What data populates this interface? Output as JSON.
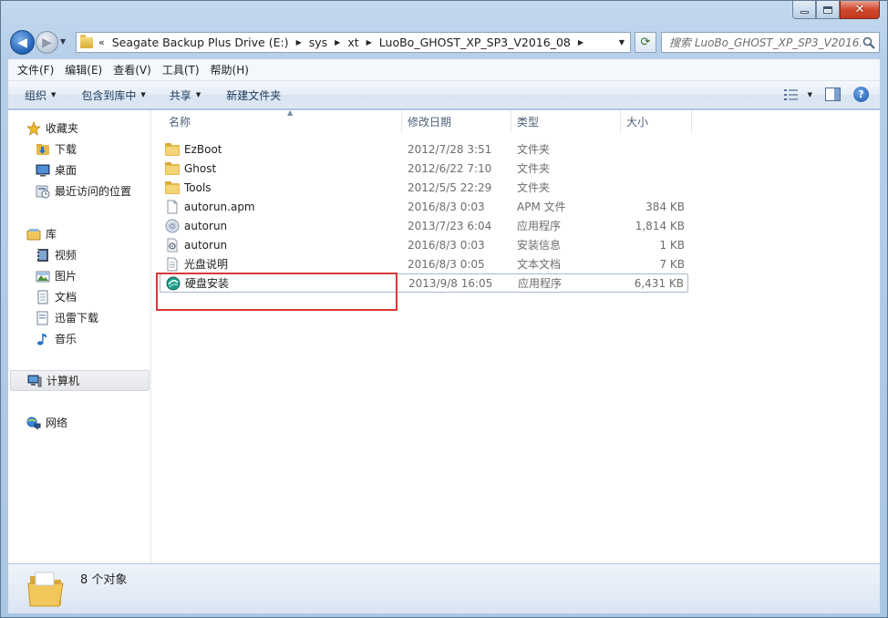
{
  "address": {
    "crumbs": [
      "Seagate Backup Plus Drive (E:)",
      "sys",
      "xt",
      "LuoBo_GHOST_XP_SP3_V2016_08"
    ],
    "overflow": "«"
  },
  "search": {
    "placeholder": "搜索 LuoBo_GHOST_XP_SP3_V2016..."
  },
  "menubar": [
    "文件(F)",
    "编辑(E)",
    "查看(V)",
    "工具(T)",
    "帮助(H)"
  ],
  "commandbar": {
    "organize": "组织",
    "include_library": "包含到库中",
    "share": "共享",
    "new_folder": "新建文件夹"
  },
  "navpane": {
    "favorites": {
      "label": "收藏夹",
      "items": [
        "下载",
        "桌面",
        "最近访问的位置"
      ]
    },
    "libraries": {
      "label": "库",
      "items": [
        "视频",
        "图片",
        "文档",
        "迅雷下载",
        "音乐"
      ]
    },
    "computer": "计算机",
    "network": "网络"
  },
  "columns": {
    "name": "名称",
    "date": "修改日期",
    "type": "类型",
    "size": "大小"
  },
  "files": [
    {
      "name": "EzBoot",
      "date": "2012/7/28 3:51",
      "type": "文件夹",
      "size": "",
      "icon": "folder-icon"
    },
    {
      "name": "Ghost",
      "date": "2012/6/22 7:10",
      "type": "文件夹",
      "size": "",
      "icon": "folder-icon"
    },
    {
      "name": "Tools",
      "date": "2012/5/5 22:29",
      "type": "文件夹",
      "size": "",
      "icon": "folder-icon"
    },
    {
      "name": "autorun.apm",
      "date": "2016/8/3 0:03",
      "type": "APM 文件",
      "size": "384 KB",
      "icon": "file-icon"
    },
    {
      "name": "autorun",
      "date": "2013/7/23 6:04",
      "type": "应用程序",
      "size": "1,814 KB",
      "icon": "disc-app-icon"
    },
    {
      "name": "autorun",
      "date": "2016/8/3 0:03",
      "type": "安装信息",
      "size": "1 KB",
      "icon": "setup-info-icon"
    },
    {
      "name": "光盘说明",
      "date": "2016/8/3 0:05",
      "type": "文本文档",
      "size": "7 KB",
      "icon": "text-file-icon"
    },
    {
      "name": "硬盘安装",
      "date": "2013/9/8 16:05",
      "type": "应用程序",
      "size": "6,431 KB",
      "icon": "installer-app-icon"
    }
  ],
  "status": {
    "count": "8 个对象"
  },
  "colors": {
    "highlight": "#d9383a",
    "folder": "#e6b94b",
    "accent": "#1f5fb3"
  }
}
